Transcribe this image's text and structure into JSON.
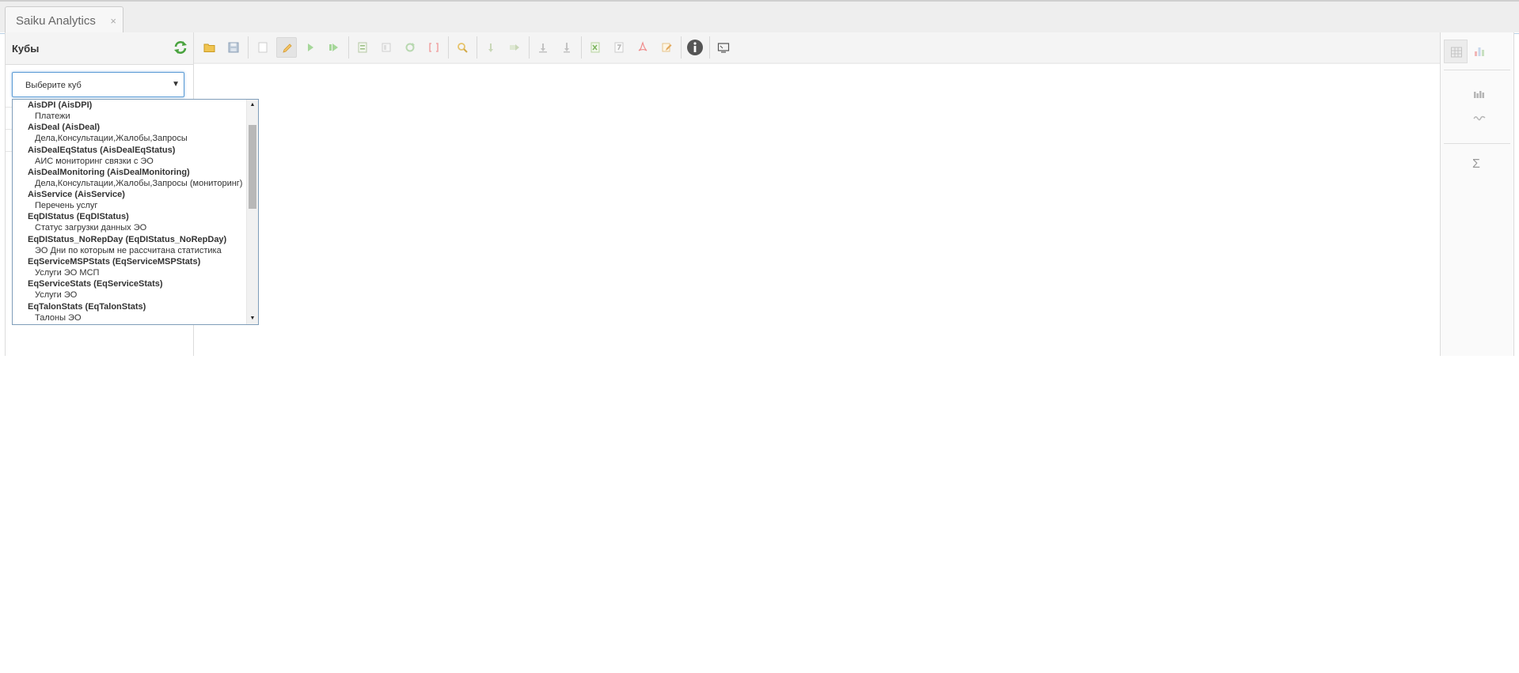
{
  "tab": {
    "title": "Saiku Analytics",
    "close": "×"
  },
  "sidebar": {
    "title": "Кубы",
    "cube_select": {
      "selected": "Выберите куб",
      "arrow": "▼"
    }
  },
  "dropdown": {
    "groups": [
      {
        "name": "AisDPI (AisDPI)",
        "items": [
          "Платежи"
        ]
      },
      {
        "name": "AisDeal (AisDeal)",
        "items": [
          "Дела,Консультации,Жалобы,Запросы"
        ]
      },
      {
        "name": "AisDealEqStatus (AisDealEqStatus)",
        "items": [
          "АИС мониторинг связки с ЭО"
        ]
      },
      {
        "name": "AisDealMonitoring (AisDealMonitoring)",
        "items": [
          "Дела,Консультации,Жалобы,Запросы (мониторинг)"
        ]
      },
      {
        "name": "AisService (AisService)",
        "items": [
          "Перечень услуг"
        ]
      },
      {
        "name": "EqDIStatus (EqDIStatus)",
        "items": [
          "Статус загрузки данных ЭО"
        ]
      },
      {
        "name": "EqDIStatus_NoRepDay (EqDIStatus_NoRepDay)",
        "items": [
          "ЭО Дни по которым не рассчитана статистика"
        ]
      },
      {
        "name": "EqServiceMSPStats (EqServiceMSPStats)",
        "items": [
          "Услуги ЭО МСП"
        ]
      },
      {
        "name": "EqServiceStats (EqServiceStats)",
        "items": [
          "Услуги ЭО"
        ]
      },
      {
        "name": "EqTalonStats (EqTalonStats)",
        "items": [
          "Талоны ЭО"
        ]
      }
    ],
    "scroll_up": "▲",
    "scroll_down": "▼"
  },
  "right_panel": {
    "sum_symbol": "Σ"
  },
  "colors": {
    "accent_blue": "#5b9bd5",
    "folder": "#e8b33a",
    "green": "#7bc26b",
    "info": "#555555"
  }
}
